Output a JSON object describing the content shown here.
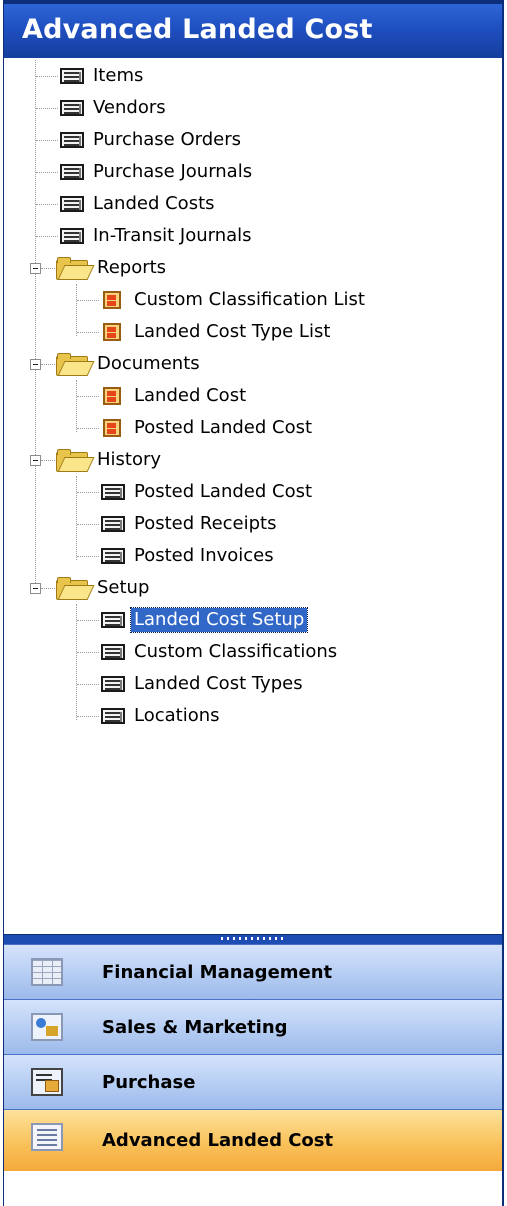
{
  "pane": {
    "title": "Advanced Landed Cost"
  },
  "tree": {
    "items": [
      {
        "label": "Items",
        "icon": "form-icon"
      },
      {
        "label": "Vendors",
        "icon": "form-icon"
      },
      {
        "label": "Purchase Orders",
        "icon": "form-icon"
      },
      {
        "label": "Purchase Journals",
        "icon": "form-icon"
      },
      {
        "label": "Landed Costs",
        "icon": "form-icon"
      },
      {
        "label": "In-Transit Journals",
        "icon": "form-icon"
      }
    ],
    "folders": [
      {
        "label": "Reports",
        "expanded": true,
        "children": [
          {
            "label": "Custom Classification List",
            "icon": "report-icon"
          },
          {
            "label": "Landed Cost Type List",
            "icon": "report-icon"
          }
        ]
      },
      {
        "label": "Documents",
        "expanded": true,
        "children": [
          {
            "label": "Landed Cost",
            "icon": "report-icon"
          },
          {
            "label": "Posted Landed Cost",
            "icon": "report-icon"
          }
        ]
      },
      {
        "label": "History",
        "expanded": true,
        "children": [
          {
            "label": "Posted Landed Cost",
            "icon": "form-icon"
          },
          {
            "label": "Posted Receipts",
            "icon": "form-icon"
          },
          {
            "label": "Posted Invoices",
            "icon": "form-icon"
          }
        ]
      },
      {
        "label": "Setup",
        "expanded": true,
        "children": [
          {
            "label": "Landed Cost Setup",
            "icon": "form-icon",
            "selected": true
          },
          {
            "label": "Custom Classifications",
            "icon": "form-icon"
          },
          {
            "label": "Landed Cost Types",
            "icon": "form-icon"
          },
          {
            "label": "Locations",
            "icon": "form-icon"
          }
        ]
      }
    ]
  },
  "nav_buttons": [
    {
      "label": "Financial Management",
      "icon": "financial-management-icon",
      "active": false
    },
    {
      "label": "Sales & Marketing",
      "icon": "sales-marketing-icon",
      "active": false
    },
    {
      "label": "Purchase",
      "icon": "purchase-icon",
      "active": false
    },
    {
      "label": "Advanced Landed Cost",
      "icon": "advanced-landed-cost-icon",
      "active": true
    }
  ],
  "colors": {
    "title_bar": "#1f4fc0",
    "selection": "#3168c7",
    "active_nav": "#f9c25b",
    "nav_button": "#b8cff4"
  }
}
